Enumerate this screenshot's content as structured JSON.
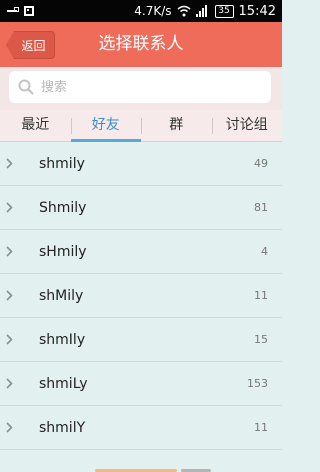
{
  "status_bar": {
    "speed": "4.7K/s",
    "battery": "35",
    "time": "15:42",
    "icons": [
      "usb-icon",
      "qr-code-icon",
      "wifi-icon",
      "signal-icon",
      "battery-icon"
    ]
  },
  "header": {
    "back_label": "返回",
    "title": "选择联系人",
    "accent_color": "#ef6c5a"
  },
  "search": {
    "placeholder": "搜索",
    "value": ""
  },
  "tabs": [
    {
      "label": "最近",
      "active": false
    },
    {
      "label": "好友",
      "active": true
    },
    {
      "label": "群",
      "active": false
    },
    {
      "label": "讨论组",
      "active": false
    }
  ],
  "contacts": [
    {
      "name": "shmily",
      "count": "49"
    },
    {
      "name": "Shmily",
      "count": "81"
    },
    {
      "name": "sHmily",
      "count": "4"
    },
    {
      "name": "shMily",
      "count": "11"
    },
    {
      "name": "shmIly",
      "count": "15"
    },
    {
      "name": "shmiLy",
      "count": "153"
    },
    {
      "name": "shmilY",
      "count": "11"
    }
  ]
}
